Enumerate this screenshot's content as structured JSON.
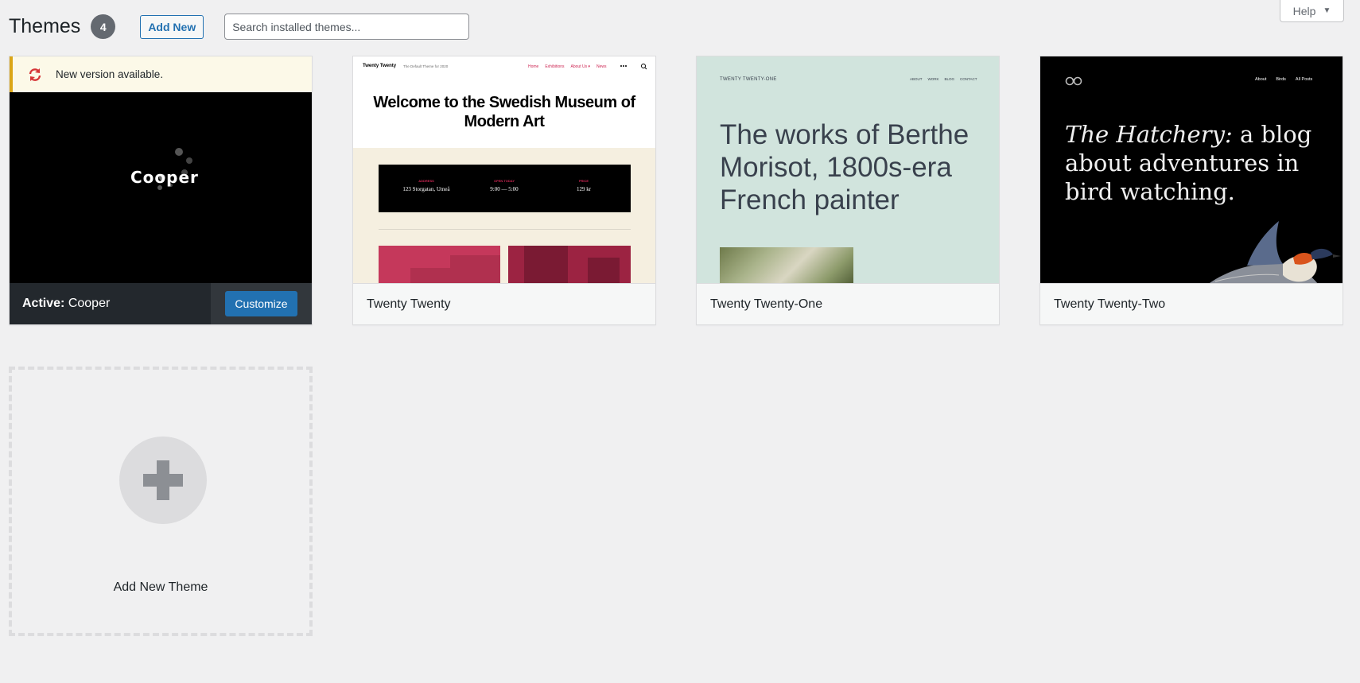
{
  "header": {
    "title": "Themes",
    "count": "4",
    "add_new_label": "Add New",
    "search_placeholder": "Search installed themes..."
  },
  "help": {
    "label": "Help"
  },
  "themes": [
    {
      "name": "Cooper",
      "active": true,
      "active_prefix": "Active:",
      "update_notice": "New version available.",
      "customize_label": "Customize",
      "screenshot": {
        "logo_text": "Cooper"
      }
    },
    {
      "name": "Twenty Twenty",
      "active": false,
      "screenshot": {
        "site_title": "Twenty Twenty",
        "tagline": "The Default Theme for 2020",
        "nav": [
          "Home",
          "Exhibitions",
          "About Us ▾",
          "News"
        ],
        "headline": "Welcome to the Swedish Museum of Modern Art",
        "info": [
          {
            "label": "ADDRESS",
            "value": "123 Storgatan, Umeå"
          },
          {
            "label": "OPEN TODAY",
            "value": "9:00 — 5:00"
          },
          {
            "label": "PRICE",
            "value": "129 kr"
          }
        ]
      }
    },
    {
      "name": "Twenty Twenty-One",
      "active": false,
      "screenshot": {
        "site_title": "TWENTY TWENTY-ONE",
        "nav": [
          "ABOUT",
          "WORK",
          "BLOG",
          "CONTACT"
        ],
        "headline": "The works of Berthe Morisot, 1800s-era French painter"
      }
    },
    {
      "name": "Twenty Twenty-Two",
      "active": false,
      "screenshot": {
        "nav": [
          "About",
          "Birds",
          "All Posts"
        ],
        "headline_italic": "The Hatchery:",
        "headline_rest": " a blog about adventures in bird watching."
      }
    }
  ],
  "add_new_theme": {
    "label": "Add New Theme"
  },
  "colors": {
    "accent": "#2271b1",
    "notice_border": "#dba617",
    "sync_icon": "#d63638"
  }
}
